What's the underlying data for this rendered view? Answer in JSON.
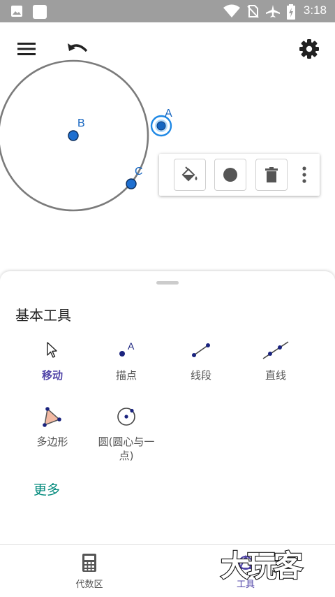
{
  "status_bar": {
    "time": "3:18"
  },
  "canvas": {
    "points": [
      {
        "name": "A",
        "label": "A"
      },
      {
        "name": "B",
        "label": "B"
      },
      {
        "name": "C",
        "label": "C"
      }
    ]
  },
  "panel": {
    "title": "基本工具",
    "tools": [
      {
        "id": "move",
        "label": "移动",
        "icon": "move-icon",
        "active": true
      },
      {
        "id": "point",
        "label": "描点",
        "icon": "point-icon"
      },
      {
        "id": "segment",
        "label": "线段",
        "icon": "segment-icon"
      },
      {
        "id": "line",
        "label": "直线",
        "icon": "line-icon"
      },
      {
        "id": "polygon",
        "label": "多边形",
        "icon": "polygon-icon"
      },
      {
        "id": "circle",
        "label": "圆(圆心与一点)",
        "icon": "circle-center-point-icon"
      }
    ],
    "more_label": "更多"
  },
  "bottom_nav": {
    "items": [
      {
        "label": "代数区",
        "icon": "calculator-icon"
      },
      {
        "label": "工具",
        "icon": "tools-icon"
      }
    ]
  },
  "watermark_text": "大玩客",
  "colors": {
    "accent": "#5145a8",
    "teal": "#00897b",
    "point": "#1565c0",
    "statusbar": "#9e9e9e"
  }
}
